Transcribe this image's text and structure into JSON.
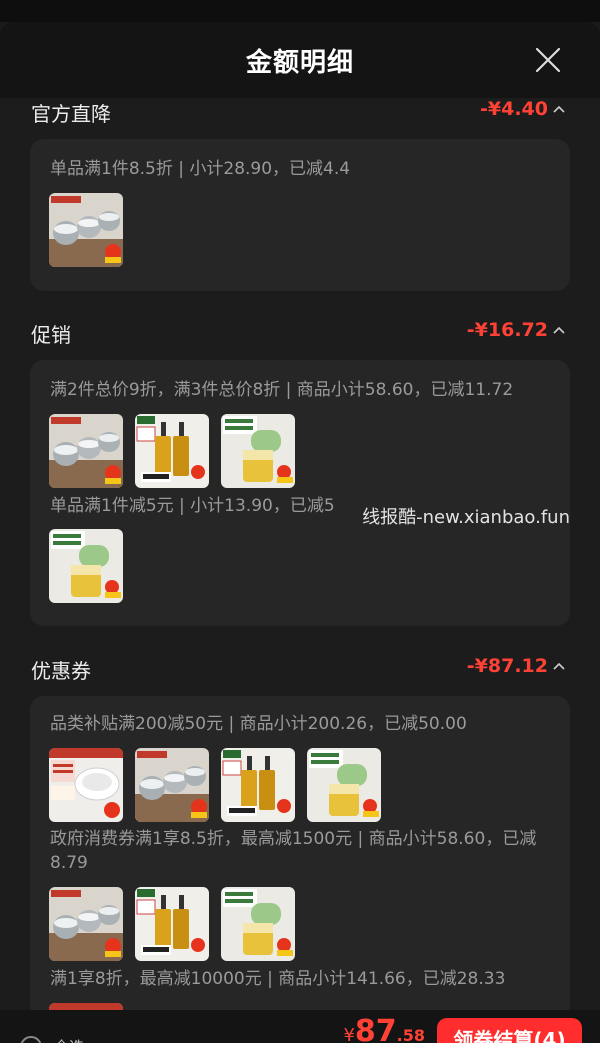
{
  "header": {
    "title": "金额明细"
  },
  "sections": [
    {
      "name": "官方直降",
      "amount": "-¥4.40",
      "rules": [
        {
          "text": "单品满1件8.5折 | 小计28.90，已减4.4",
          "products": [
            "spice-jars"
          ]
        }
      ]
    },
    {
      "name": "促销",
      "amount": "-¥16.72",
      "rules": [
        {
          "text": "满2件总价9折，满3件总价8折 | 商品小计58.60，已减11.72",
          "products": [
            "spice-jars",
            "oil-bottles",
            "oil-sprayer"
          ]
        },
        {
          "text": "单品满1件减5元 | 小计13.90，已减5",
          "products": [
            "oil-sprayer"
          ]
        }
      ]
    },
    {
      "name": "优惠券",
      "amount": "-¥87.12",
      "rules": [
        {
          "text": "品类补贴满200减50元 | 商品小计200.26，已减50.00",
          "products": [
            "bowl",
            "spice-jars",
            "oil-bottles",
            "oil-sprayer"
          ]
        },
        {
          "text": "政府消费券满1享8.5折，最高减1500元 | 商品小计58.60，已减8.79",
          "products": [
            "spice-jars",
            "oil-bottles",
            "oil-sprayer"
          ]
        },
        {
          "text": "满1享8折，最高减10000元 | 商品小计141.66，已减28.33",
          "products": [
            "bowl"
          ]
        }
      ]
    }
  ],
  "watermark": "线报酷-new.xianbao.fun",
  "footer": {
    "select_all": "全选",
    "currency": "¥",
    "total_int": "87",
    "total_dec": ".58",
    "checkout_label": "领券结算(4)"
  },
  "colors": {
    "accent": "#ff2d2d",
    "discount": "#ff4136"
  },
  "icons": {
    "close": "close-icon",
    "collapse": "chevron-up-icon"
  }
}
